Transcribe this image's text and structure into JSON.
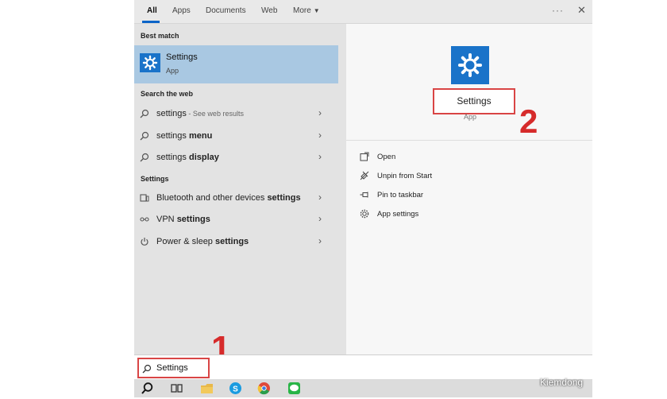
{
  "tabs": [
    "All",
    "Apps",
    "Documents",
    "Web",
    "More"
  ],
  "best_match": {
    "section": "Best match",
    "title": "Settings",
    "subtitle": "App"
  },
  "web_section": "Search the web",
  "web_results": [
    {
      "term": "settings",
      "hint": " - See web results",
      "bold": ""
    },
    {
      "term": "settings ",
      "hint": "",
      "bold": "menu"
    },
    {
      "term": "settings ",
      "hint": "",
      "bold": "display"
    }
  ],
  "settings_section": "Settings",
  "settings_results": [
    {
      "text": "Bluetooth and other devices ",
      "bold": "settings",
      "icon": "bluetooth-devices-icon"
    },
    {
      "text": "VPN ",
      "bold": "settings",
      "icon": "vpn-icon"
    },
    {
      "text": "Power & sleep ",
      "bold": "settings",
      "icon": "power-icon"
    }
  ],
  "detail": {
    "title": "Settings",
    "type": "App",
    "actions": [
      "Open",
      "Unpin from Start",
      "Pin to taskbar",
      "App settings"
    ]
  },
  "annotations": {
    "step1": "1",
    "step2": "2"
  },
  "search": {
    "value": "Settings"
  },
  "watermark": "Kiemdong",
  "colors": {
    "accent": "#1a73c9",
    "highlight": "#a9c8e2",
    "annotation_red": "#d62b2b"
  }
}
